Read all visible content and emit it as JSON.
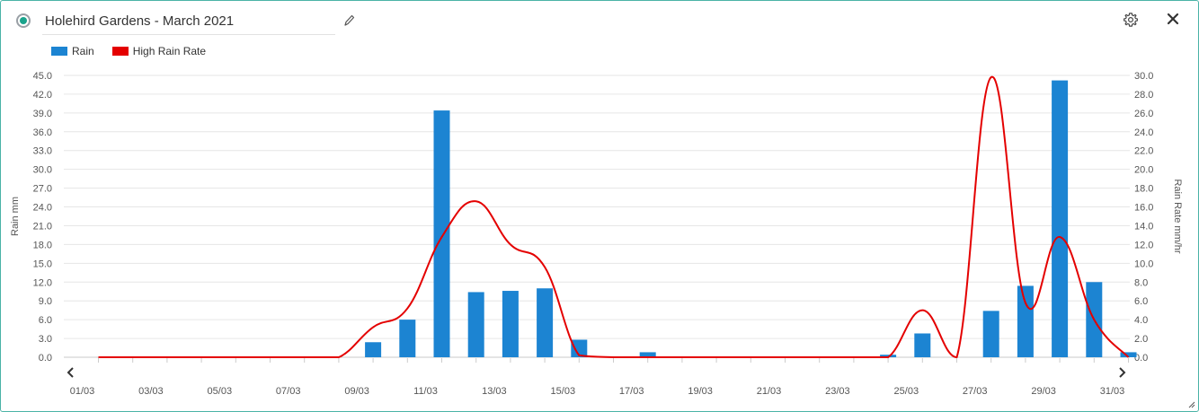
{
  "header": {
    "title": "Holehird Gardens - March 2021"
  },
  "icons": {
    "status": "status-radio-icon",
    "edit": "pencil-icon",
    "settings": "gear-icon",
    "close": "close-icon"
  },
  "colors": {
    "rain": "#1c84d2",
    "rate": "#e40000",
    "accent": "#1aa38c"
  },
  "chart_data": {
    "type": "bar",
    "legend": [
      "Rain",
      "High Rain Rate"
    ],
    "legend_position": "top-left",
    "grid": true,
    "x": [
      "01/03",
      "02/03",
      "03/03",
      "04/03",
      "05/03",
      "06/03",
      "07/03",
      "08/03",
      "09/03",
      "10/03",
      "11/03",
      "12/03",
      "13/03",
      "14/03",
      "15/03",
      "16/03",
      "17/03",
      "18/03",
      "19/03",
      "20/03",
      "21/03",
      "22/03",
      "23/03",
      "24/03",
      "25/03",
      "26/03",
      "27/03",
      "28/03",
      "29/03",
      "30/03",
      "31/03"
    ],
    "xtick_labels": [
      "01/03",
      "03/03",
      "05/03",
      "07/03",
      "09/03",
      "11/03",
      "13/03",
      "15/03",
      "17/03",
      "19/03",
      "21/03",
      "23/03",
      "25/03",
      "27/03",
      "29/03",
      "31/03"
    ],
    "ylabel": "Rain mm",
    "y2label": "Rain Rate mm/hr",
    "ylim": [
      0,
      45
    ],
    "y2lim": [
      0,
      30
    ],
    "yticks": [
      "0.0",
      "3.0",
      "6.0",
      "9.0",
      "12.0",
      "15.0",
      "18.0",
      "21.0",
      "24.0",
      "27.0",
      "30.0",
      "33.0",
      "36.0",
      "39.0",
      "42.0",
      "45.0"
    ],
    "y2ticks": [
      "0.0",
      "2.0",
      "4.0",
      "6.0",
      "8.0",
      "10.0",
      "12.0",
      "14.0",
      "16.0",
      "18.0",
      "20.0",
      "22.0",
      "24.0",
      "26.0",
      "28.0",
      "30.0"
    ],
    "series": [
      {
        "name": "Rain",
        "type": "bar",
        "axis": "left",
        "values": [
          0,
          0,
          0,
          0,
          0,
          0,
          0,
          0,
          2.4,
          6.0,
          39.4,
          10.4,
          10.6,
          11.0,
          2.8,
          0,
          0.8,
          0,
          0,
          0,
          0,
          0,
          0,
          0.4,
          3.8,
          0,
          7.4,
          11.4,
          44.2,
          12.0,
          0.8
        ]
      },
      {
        "name": "High Rain Rate",
        "type": "line",
        "axis": "right",
        "values": [
          0,
          0,
          0,
          0,
          0,
          0,
          0,
          0,
          3.2,
          5.2,
          12.8,
          16.6,
          12.0,
          9.6,
          0.2,
          0,
          0,
          0,
          0,
          0,
          0,
          0,
          0,
          0,
          5.0,
          0,
          29.8,
          5.8,
          12.8,
          4.0,
          0
        ]
      }
    ]
  }
}
